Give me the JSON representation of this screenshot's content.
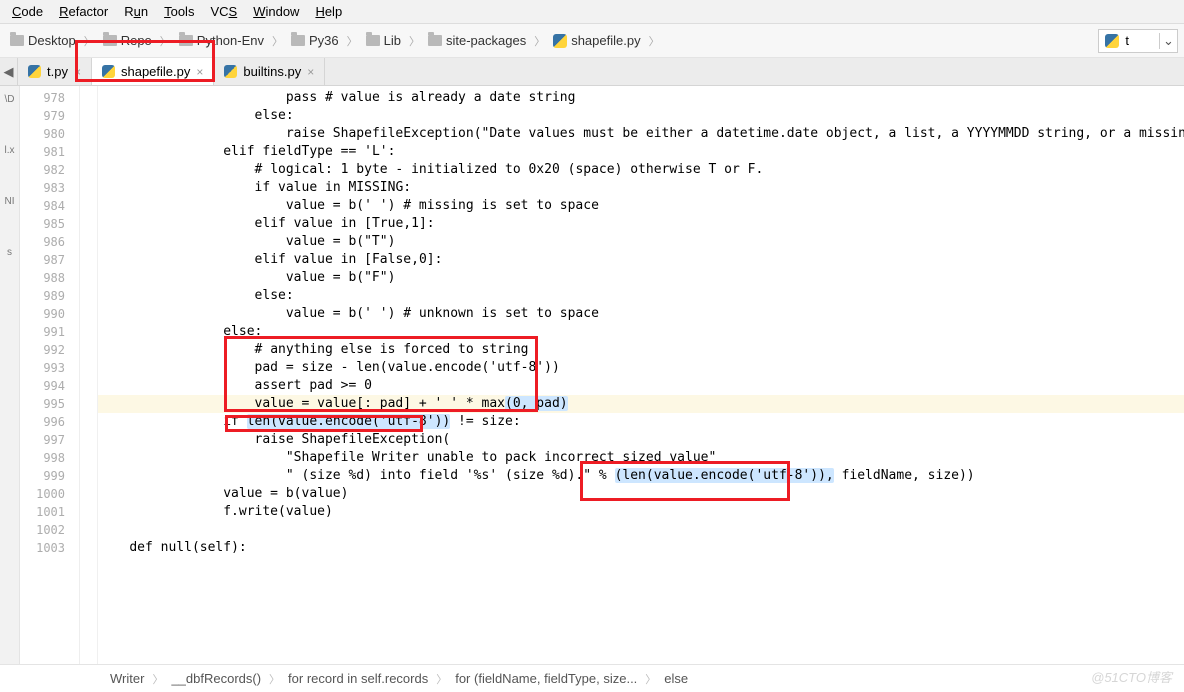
{
  "menu": {
    "items": [
      "Code",
      "Refactor",
      "Run",
      "Tools",
      "VCS",
      "Window",
      "Help"
    ]
  },
  "breadcrumbs": [
    {
      "label": "Desktop",
      "icon": "folder"
    },
    {
      "label": "Repo",
      "icon": "folder"
    },
    {
      "label": "Python-Env",
      "icon": "folder"
    },
    {
      "label": "Py36",
      "icon": "folder"
    },
    {
      "label": "Lib",
      "icon": "folder"
    },
    {
      "label": "site-packages",
      "icon": "folder"
    },
    {
      "label": "shapefile.py",
      "icon": "python"
    }
  ],
  "run_config": {
    "label": "t"
  },
  "tabs": [
    {
      "label": "t.py",
      "active": false
    },
    {
      "label": "shapefile.py",
      "active": true
    },
    {
      "label": "builtins.py",
      "active": false
    }
  ],
  "side_labels": [
    "\\D",
    "l.x",
    "NI",
    "s"
  ],
  "gutter_start": 978,
  "gutter_end": 1003,
  "code_lines": [
    {
      "n": 978,
      "t": "                        <kw>pass</kw> <cm># value is already a date string</cm>"
    },
    {
      "n": 979,
      "t": "                    <kw>else</kw>:"
    },
    {
      "n": 980,
      "t": "                        <kw>raise</kw> ShapefileException(<str>\"Date values must be either a datetime.date object, a list, a YYYYMMDD string, or a missing value</str>"
    },
    {
      "n": 981,
      "t": "                <kw>elif</kw> fieldType == <str>'L'</str>:"
    },
    {
      "n": 982,
      "t": "                    <cm># logical: 1 byte - initialized to 0x20 (space) otherwise T or F.</cm>"
    },
    {
      "n": 983,
      "t": "                    <kw>if</kw> value <kw>in</kw> MISSING:"
    },
    {
      "n": 984,
      "t": "                        value = b(<str>' '</str>) <cm># missing is set to space</cm>"
    },
    {
      "n": 985,
      "t": "                    <kw>elif</kw> value <kw>in</kw> [<kw>True</kw>,<num>1</num>]:"
    },
    {
      "n": 986,
      "t": "                        value = b(<str>\"T\"</str>)"
    },
    {
      "n": 987,
      "t": "                    <kw>elif</kw> value <kw>in</kw> [<kw>False</kw>,<num>0</num>]:"
    },
    {
      "n": 988,
      "t": "                        value = b(<str>\"F\"</str>)"
    },
    {
      "n": 989,
      "t": "                    <kw>else</kw>:"
    },
    {
      "n": 990,
      "t": "                        value = b(<str>' '</str>) <cm># unknown is set to space</cm>"
    },
    {
      "n": 991,
      "t": "                <kw>else</kw>:"
    },
    {
      "n": 992,
      "t": "                    <cm># anything else is forced to string</cm>"
    },
    {
      "n": 993,
      "t": "                    pad = size - <builtin>len</builtin>(value.encode(<str>'utf-8'</str>))"
    },
    {
      "n": 994,
      "t": "                    <kw>assert</kw> pad &gt;= <num>0</num>"
    },
    {
      "n": 995,
      "t": "                    value = value[: pad] + <str>' '</str> * <builtin>max</builtin><span class=\"hl-sel\">(<num>0</num>, pad)</span>",
      "hl": true
    },
    {
      "n": 996,
      "t": "                <kw>if</kw> <span class=\"hl-sel\"><builtin>len</builtin>(value.encode(<str>'utf-8'</str>))</span> != size:"
    },
    {
      "n": 997,
      "t": "                    <kw>raise</kw> ShapefileException("
    },
    {
      "n": 998,
      "t": "                        <str>\"Shapefile Writer unable to pack incorrect sized value\"</str>"
    },
    {
      "n": 999,
      "t": "                        <str>\" (size %d) into field '%s' (size %d).\"</str> % <span class=\"hl-sel\">(<builtin>len</builtin>(value.encode(<str>'utf-8'</str>)),</span> fieldName, size))"
    },
    {
      "n": 1000,
      "t": "                value = b(value)"
    },
    {
      "n": 1001,
      "t": "                f.write(value)"
    },
    {
      "n": 1002,
      "t": ""
    },
    {
      "n": 1003,
      "t": "    <kw>def</kw> <fn>null</fn>(<self>self</self>):"
    }
  ],
  "context": [
    "Writer",
    "__dbfRecords()",
    "for record in self.records",
    "for (fieldName, fieldType, size...",
    "else"
  ],
  "watermark": "@51CTO博客"
}
